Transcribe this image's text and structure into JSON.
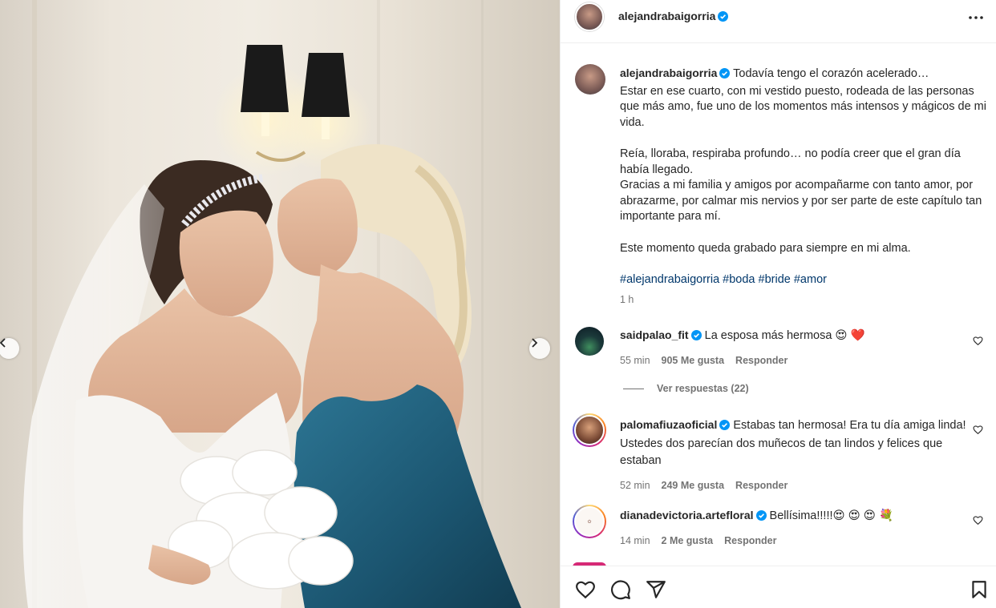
{
  "post": {
    "author": "alejandrabaigorria",
    "caption_lines": [
      "Todavía tengo el corazón acelerado…",
      "Estar en ese cuarto, con mi vestido puesto, rodeada de las personas que más amo, fue uno de los momentos más intensos y mágicos de mi vida.",
      "Reía, lloraba, respiraba profundo… no podía creer que el gran día había llegado.",
      "Gracias a mi familia y amigos por acompañarme con tanto amor, por abrazarme, por calmar mis nervios y por ser parte de este capítulo tan importante para mí.",
      "Este momento queda grabado para siempre en mi alma."
    ],
    "hashtags": "#alejandrabaigorria #boda #bride #amor",
    "time": "1 h"
  },
  "comments": [
    {
      "user": "saidpalao_fit",
      "text": "La esposa más hermosa 😍 ❤️",
      "time": "55 min",
      "likes": "905 Me gusta",
      "reply": "Responder",
      "view_replies": "Ver respuestas (22)"
    },
    {
      "user": "palomafiuzaoficial",
      "text": "Estabas tan hermosa! Era tu día amiga linda! Ustedes dos parecían dos muñecos de tan lindos y felices que estaban",
      "time": "52 min",
      "likes": "249 Me gusta",
      "reply": "Responder"
    },
    {
      "user": "dianadevictoria.artefloral",
      "text": "Bellísima!!!!!😍 😍 😍 💐",
      "time": "14 min",
      "likes": "2 Me gusta",
      "reply": "Responder"
    }
  ],
  "icons": {
    "verified": "verified-badge",
    "more": "more-options",
    "like": "heart",
    "comment": "speech-bubble",
    "share": "paper-plane",
    "save": "bookmark"
  },
  "colors": {
    "verified": "#0095f6",
    "link": "#00376b",
    "muted": "#737373",
    "text": "#262626"
  }
}
